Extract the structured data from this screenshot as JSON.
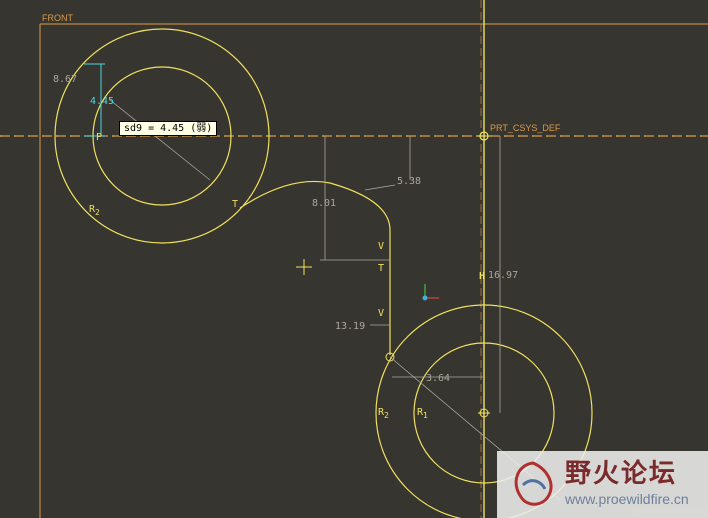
{
  "view": {
    "datum_plane_label": "FRONT",
    "csys_label": "PRT_CSYS_DEF"
  },
  "tooltip": {
    "text": "sd9 = 4.45  (弱)"
  },
  "dimensions": {
    "d_top_left": "8.67",
    "d_cyan": "4.45",
    "d_vertical_mid": "8.01",
    "d_538": "5.38",
    "d_1319": "13.19",
    "d_1697": "16.97",
    "d_364": "3.64"
  },
  "constraints": {
    "radius_label_top": "R",
    "radius_sub_top": "2",
    "r2_label": "R",
    "r2_sub": "2",
    "r1_label": "R",
    "r1_sub": "1",
    "t_upper": "T",
    "t_mid": "T",
    "v_upper": "V",
    "v_lower": "V",
    "h_marker": "H",
    "p_marker": "P"
  },
  "watermark": {
    "site_name": "野火论坛",
    "url": "www.proewildfire.cn"
  },
  "colors": {
    "background": "#37352f",
    "geometry": "#f0e060",
    "dimension": "#a8a79d",
    "weak_dimension": "#48d8e0",
    "datum": "#d89a4a",
    "centerline": "#f0e060"
  }
}
